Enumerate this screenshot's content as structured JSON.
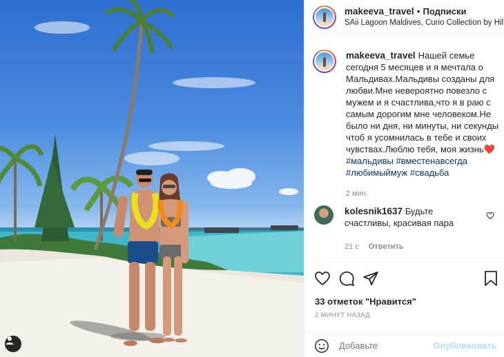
{
  "post": {
    "username": "makeeva_travel",
    "separator": "•",
    "follow_label": "Подписки",
    "location": "SAii Lagoon Maldives, Curio Collection by Hilto",
    "caption": "Нашей семье сегодня 5 месяцев и я мечтала о Мальдивах.Мальдивы созданы для любви.Мне невероятно повезло с мужем и я счастлива,что я в раю с самым дорогим мне человеком.Не было ни дня, ни минуты, ни секунды чтоб я усомнилась в тебе и своих чувствах.Люблю тебя, моя жизнь",
    "caption_emoji": "❤️",
    "hashtags": "#мальдивы #вместенавсегда #любимыймуж #свадьба",
    "caption_time": "2 мин.",
    "likes": "33 отметок \"Нравится\"",
    "posted_ago": "2 МИНУТ НАЗАД"
  },
  "comment": {
    "username": "kolesnik1637",
    "text": "Будьте счастливы, красивая пара",
    "time": "21 с",
    "reply_label": "Ответить"
  },
  "add_comment": {
    "placeholder": "Добавьте",
    "publish_label": "Опубликовать"
  },
  "icons": {
    "like": "heart-icon",
    "comment": "comment-icon",
    "share": "share-icon",
    "save": "bookmark-icon",
    "emoji": "emoji-icon",
    "tag": "user-tag-icon"
  },
  "colors": {
    "text": "#262626",
    "muted": "#8e8e8e",
    "hashtag": "#00376b",
    "publish_disabled": "#b2dffc",
    "heart_emoji": "#ed4956"
  }
}
